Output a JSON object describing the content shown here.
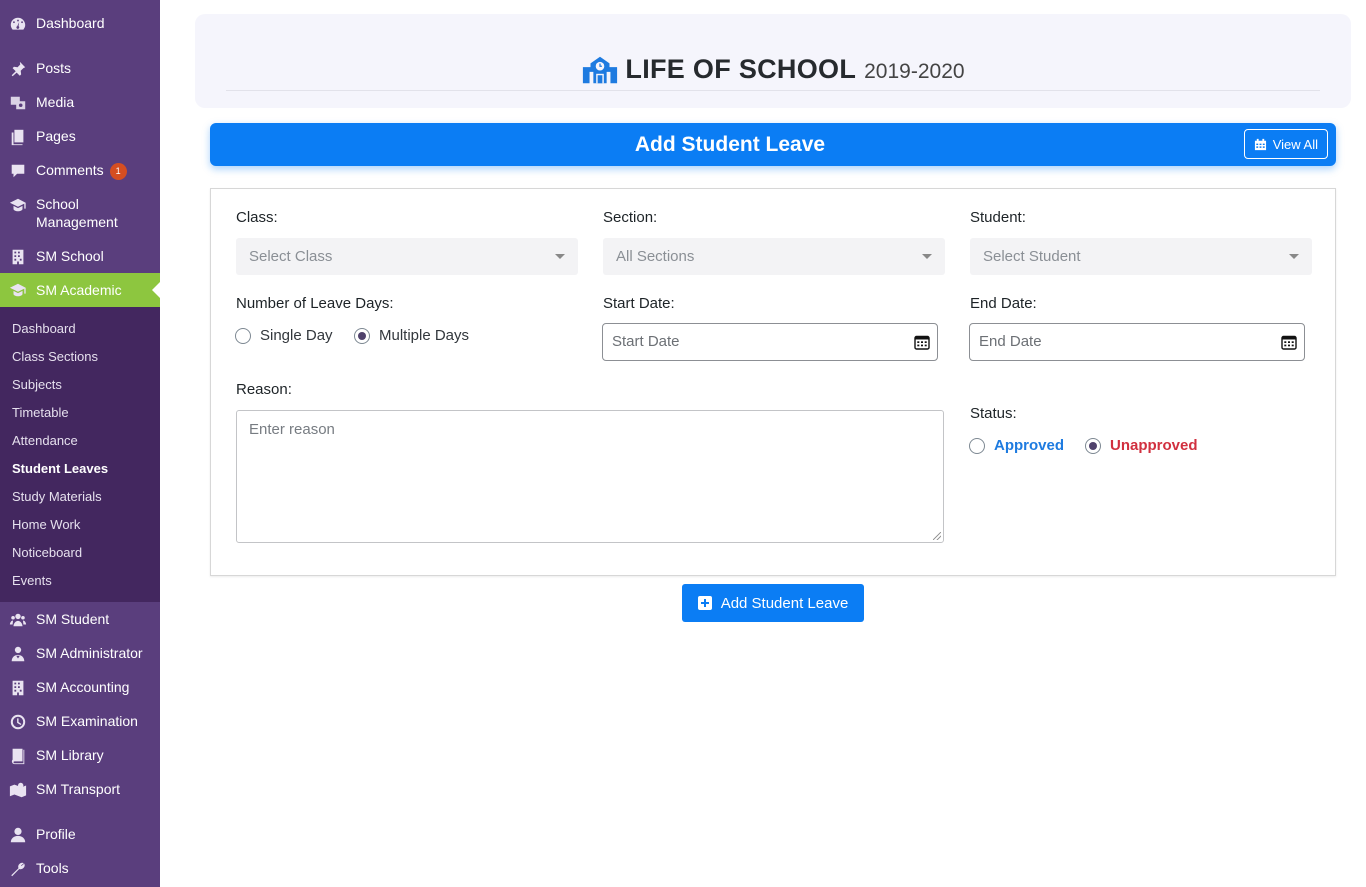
{
  "sidebar": {
    "menu": [
      {
        "label": "Dashboard",
        "icon": "dashboard-icon"
      },
      {
        "label": "Posts",
        "icon": "pin-icon"
      },
      {
        "label": "Media",
        "icon": "media-icon"
      },
      {
        "label": "Pages",
        "icon": "pages-icon"
      },
      {
        "label": "Comments",
        "icon": "comment-icon",
        "badge": "1"
      },
      {
        "label": "School Management",
        "icon": "graduation-cap-icon"
      },
      {
        "label": "SM School",
        "icon": "building-icon"
      },
      {
        "label": "SM Academic",
        "icon": "graduation-cap-icon",
        "active": true
      }
    ],
    "submenu": [
      "Dashboard",
      "Class Sections",
      "Subjects",
      "Timetable",
      "Attendance",
      "Student Leaves",
      "Study Materials",
      "Home Work",
      "Noticeboard",
      "Events"
    ],
    "submenu_current": "Student Leaves",
    "menu_lower": [
      {
        "label": "SM Student",
        "icon": "users-icon"
      },
      {
        "label": "SM Administrator",
        "icon": "admin-icon"
      },
      {
        "label": "SM Accounting",
        "icon": "building-icon"
      },
      {
        "label": "SM Examination",
        "icon": "clock-icon"
      },
      {
        "label": "SM Library",
        "icon": "book-icon"
      },
      {
        "label": "SM Transport",
        "icon": "map-icon"
      },
      {
        "label": "Profile",
        "icon": "user-icon"
      },
      {
        "label": "Tools",
        "icon": "wrench-icon"
      }
    ]
  },
  "header": {
    "school_name": "LIFE OF SCHOOL",
    "session": "2019-2020",
    "icon": "school-icon"
  },
  "title_bar": {
    "title": "Add Student Leave",
    "view_all_label": "View All"
  },
  "form": {
    "class_label": "Class:",
    "class_placeholder": "Select Class",
    "section_label": "Section:",
    "section_value": "All Sections",
    "student_label": "Student:",
    "student_placeholder": "Select Student",
    "leave_days_label": "Number of Leave Days:",
    "leave_days_options": [
      "Single Day",
      "Multiple Days"
    ],
    "leave_days_selected": "Multiple Days",
    "start_date_label": "Start Date:",
    "start_date_placeholder": "Start Date",
    "end_date_label": "End Date:",
    "end_date_placeholder": "End Date",
    "reason_label": "Reason:",
    "reason_placeholder": "Enter reason",
    "status_label": "Status:",
    "status_options": [
      "Approved",
      "Unapproved"
    ],
    "status_selected": "Unapproved"
  },
  "submit_label": "Add Student Leave",
  "colors": {
    "sidebar_bg": "#5a3e7d",
    "submenu_bg": "#43275f",
    "active_menu": "#8dc63f",
    "primary": "#0b7df4",
    "approved": "#1e7be0",
    "unapproved": "#d1303f"
  }
}
